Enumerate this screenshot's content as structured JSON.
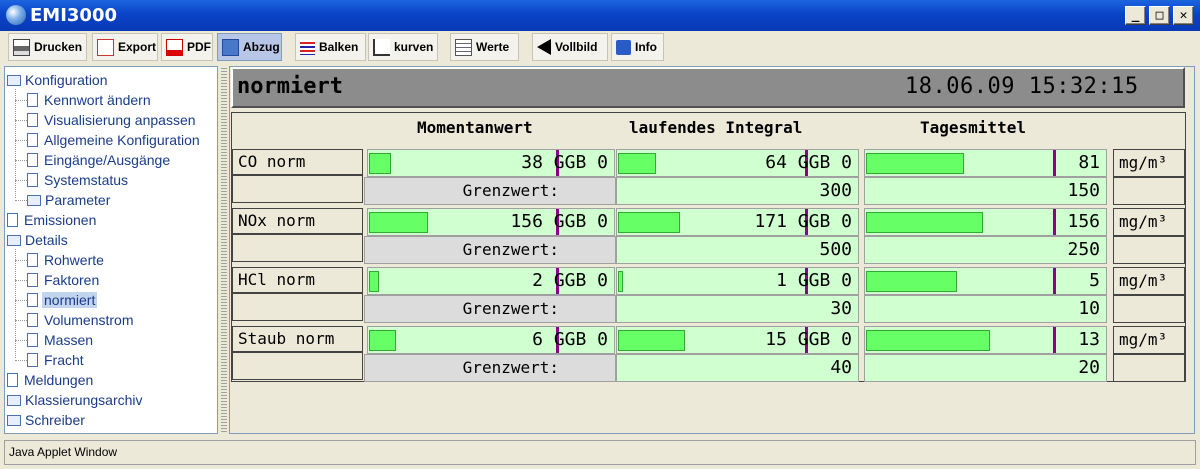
{
  "window": {
    "title": "EMI3000"
  },
  "toolbar": [
    {
      "label": "Drucken",
      "icon": "printer-icon",
      "active": false
    },
    {
      "label": "Export",
      "icon": "export-icon",
      "active": false
    },
    {
      "label": "PDF",
      "icon": "pdf-icon",
      "active": false
    },
    {
      "label": "Abzug",
      "icon": "screenshot-icon",
      "active": true
    },
    {
      "label": "Balken",
      "icon": "bars-icon",
      "active": false
    },
    {
      "label": "kurven",
      "icon": "curve-icon",
      "active": false
    },
    {
      "label": "Werte",
      "icon": "table-icon",
      "active": false
    },
    {
      "label": "Vollbild",
      "icon": "arrow-left-icon",
      "active": false
    },
    {
      "label": "Info",
      "icon": "info-icon",
      "active": false
    }
  ],
  "tree": [
    {
      "label": "Konfiguration",
      "type": "folder",
      "depth": 0
    },
    {
      "label": "Kennwort ändern",
      "type": "doc",
      "depth": 1
    },
    {
      "label": "Visualisierung anpassen",
      "type": "doc",
      "depth": 1
    },
    {
      "label": "Allgemeine Konfiguration",
      "type": "doc",
      "depth": 1
    },
    {
      "label": "Eingänge/Ausgänge",
      "type": "doc",
      "depth": 1
    },
    {
      "label": "Systemstatus",
      "type": "doc",
      "depth": 1
    },
    {
      "label": "Parameter",
      "type": "folder",
      "depth": 1
    },
    {
      "label": "Emissionen",
      "type": "doc",
      "depth": 0
    },
    {
      "label": "Details",
      "type": "folder",
      "depth": 0
    },
    {
      "label": "Rohwerte",
      "type": "doc",
      "depth": 1
    },
    {
      "label": "Faktoren",
      "type": "doc",
      "depth": 1
    },
    {
      "label": "normiert",
      "type": "doc",
      "depth": 1,
      "selected": true
    },
    {
      "label": "Volumenstrom",
      "type": "doc",
      "depth": 1
    },
    {
      "label": "Massen",
      "type": "doc",
      "depth": 1
    },
    {
      "label": "Fracht",
      "type": "doc",
      "depth": 1
    },
    {
      "label": "Meldungen",
      "type": "doc",
      "depth": 0
    },
    {
      "label": "Klassierungsarchiv",
      "type": "folder",
      "depth": 0
    },
    {
      "label": "Schreiber",
      "type": "folder",
      "depth": 0
    }
  ],
  "panel": {
    "title": "normiert",
    "datetime": "18.06.09 15:32:15",
    "columns": [
      "Momentanwert",
      "laufendes Integral",
      "Tagesmittel"
    ],
    "grenzwert_label": "Grenzwert:",
    "rows": [
      {
        "name": "CO norm",
        "unit": "mg/m³",
        "momentan": {
          "text": "38 GGB 0",
          "fill": 0.09
        },
        "integral": {
          "text": "64 GGB 0",
          "fill": 0.16
        },
        "tages": {
          "text": "81",
          "fill": 0.41
        },
        "grenz_integral": "300",
        "grenz_tages": "150"
      },
      {
        "name": "NOx norm",
        "unit": "mg/m³",
        "momentan": {
          "text": "156 GGB 0",
          "fill": 0.24
        },
        "integral": {
          "text": "171 GGB 0",
          "fill": 0.26
        },
        "tages": {
          "text": "156",
          "fill": 0.49
        },
        "grenz_integral": "500",
        "grenz_tages": "250"
      },
      {
        "name": "HCl norm",
        "unit": "mg/m³",
        "momentan": {
          "text": "2 GGB 0",
          "fill": 0.04
        },
        "integral": {
          "text": "1 GGB 0",
          "fill": 0.02
        },
        "tages": {
          "text": "5",
          "fill": 0.38
        },
        "grenz_integral": "30",
        "grenz_tages": "10"
      },
      {
        "name": "Staub norm",
        "unit": "mg/m³",
        "momentan": {
          "text": "6 GGB 0",
          "fill": 0.11
        },
        "integral": {
          "text": "15 GGB 0",
          "fill": 0.28
        },
        "tages": {
          "text": "13",
          "fill": 0.52
        },
        "grenz_integral": "40",
        "grenz_tages": "20"
      }
    ]
  },
  "statusbar": {
    "text": "Java Applet Window"
  },
  "colors": {
    "fill": "#66ff66",
    "cell": "#d0ffd0",
    "marker": "#8b008b",
    "titlebar": "#0a44c7"
  }
}
